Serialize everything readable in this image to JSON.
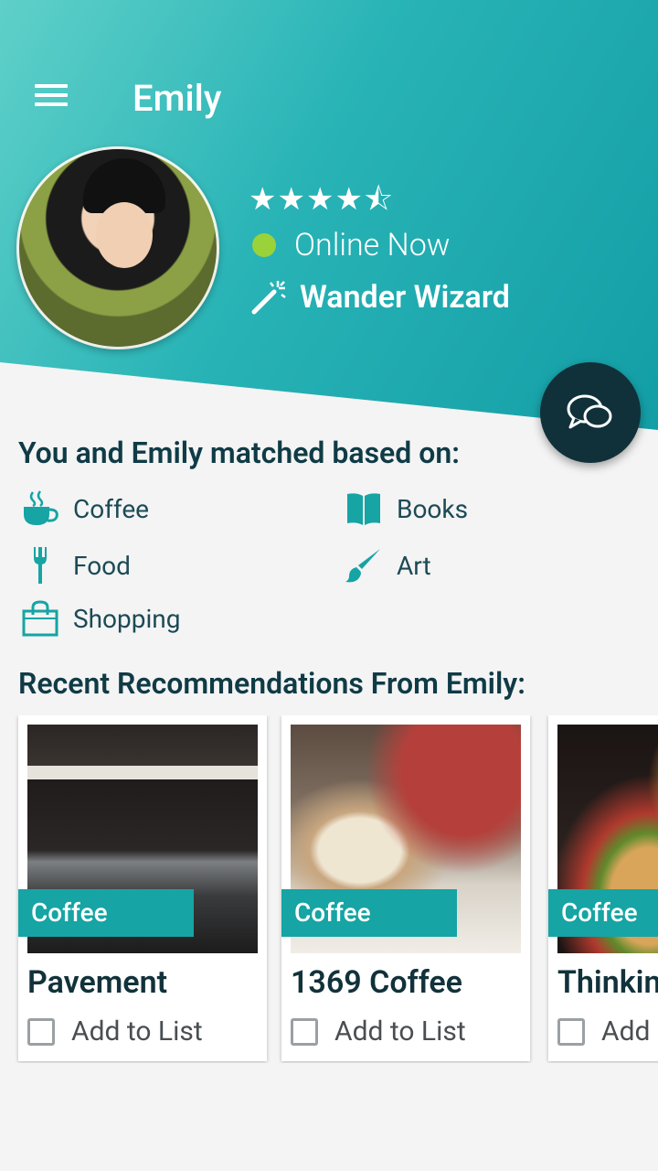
{
  "header": {
    "title": "Emily",
    "rating": "★★★★⯪",
    "status": "Online Now",
    "badge": "Wander Wizard"
  },
  "matches": {
    "heading": "You and Emily matched based on:",
    "items": [
      {
        "label": "Coffee",
        "icon": "coffee-cup-icon"
      },
      {
        "label": "Books",
        "icon": "book-icon"
      },
      {
        "label": "Food",
        "icon": "fork-icon"
      },
      {
        "label": "Art",
        "icon": "paintbrush-icon"
      },
      {
        "label": "Shopping",
        "icon": "shopping-bag-icon"
      }
    ]
  },
  "recommendations": {
    "heading": "Recent Recommendations From Emily:",
    "cards": [
      {
        "category": "Coffee",
        "name": "Pavement",
        "action": "Add to List"
      },
      {
        "category": "Coffee",
        "name": "1369 Coffee",
        "action": "Add to List"
      },
      {
        "category": "Coffee",
        "name": "Thinkin",
        "action": "Add"
      }
    ]
  },
  "colors": {
    "teal": "#16a4a4",
    "dark": "#10313a",
    "online": "#9ad23a"
  }
}
